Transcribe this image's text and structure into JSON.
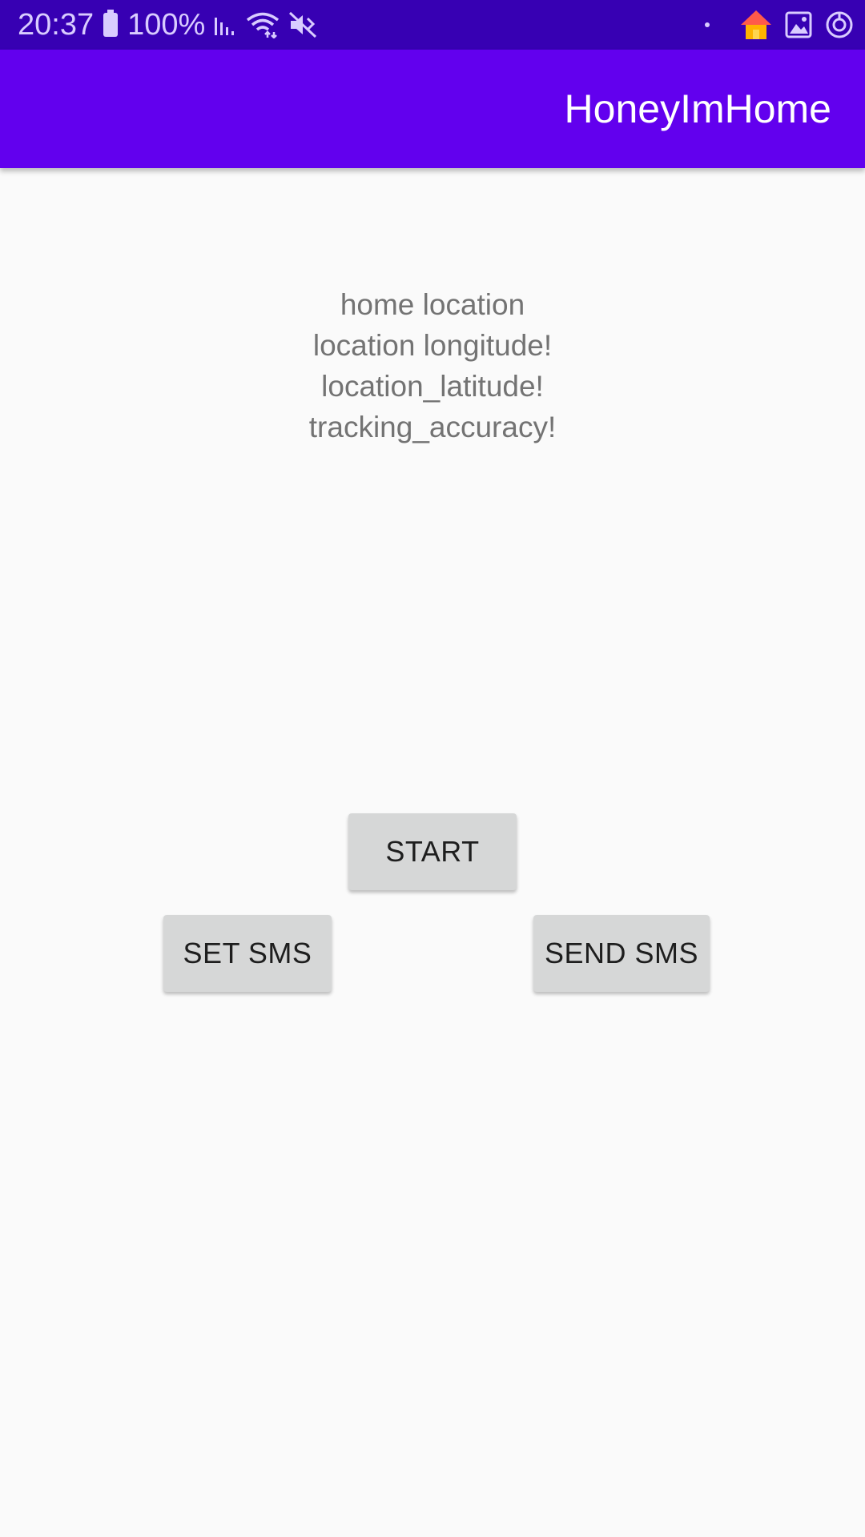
{
  "status_bar": {
    "time": "20:37",
    "battery_percent": "100%",
    "background_color": "#3700b3",
    "left_icons": [
      "battery-icon",
      "signal-icon",
      "wifi-icon",
      "mute-vibrate-icon"
    ],
    "right_icons": [
      "notification-dot-icon",
      "home-app-icon",
      "gallery-icon",
      "sync-icon"
    ]
  },
  "app_bar": {
    "title": "HoneyImHome",
    "background_color": "#6200ee"
  },
  "info": {
    "home_location": "home location",
    "longitude": "location longitude!",
    "latitude": "location_latitude!",
    "accuracy": "tracking_accuracy!"
  },
  "buttons": {
    "start_label": "START",
    "set_sms_label": "SET SMS",
    "send_sms_label": "SEND SMS",
    "background_color": "#d6d7d7"
  }
}
